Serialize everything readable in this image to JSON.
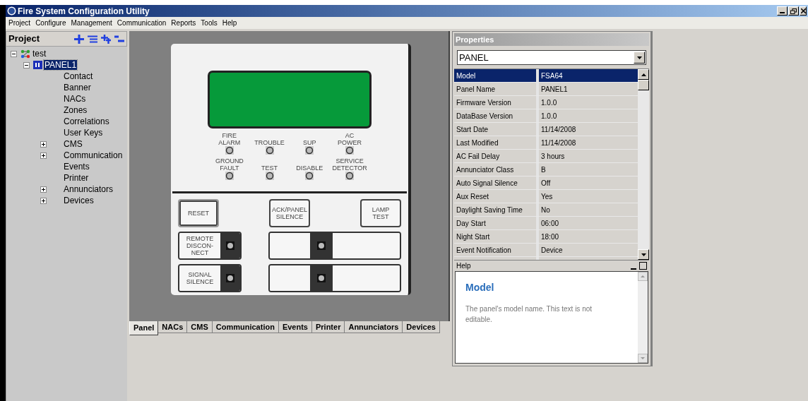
{
  "window": {
    "title": "Fire System Configuration Utility"
  },
  "menu": [
    "Project",
    "Configure",
    "Management",
    "Communication",
    "Reports",
    "Tools",
    "Help"
  ],
  "project": {
    "title": "Project",
    "tree": [
      {
        "label": "test",
        "kind": "root",
        "expanded": true,
        "selected": false,
        "children": [
          {
            "label": "PANEL1",
            "kind": "panel",
            "expanded": true,
            "selected": true,
            "children": [
              {
                "label": "Contact",
                "kind": "leaf",
                "selected": false
              },
              {
                "label": "Banner",
                "kind": "leaf",
                "selected": false
              },
              {
                "label": "NACs",
                "kind": "leaf",
                "selected": false
              },
              {
                "label": "Zones",
                "kind": "leaf",
                "selected": false
              },
              {
                "label": "Correlations",
                "kind": "leaf",
                "selected": false
              },
              {
                "label": "User Keys",
                "kind": "leaf",
                "selected": false
              },
              {
                "label": "CMS",
                "kind": "folder",
                "expanded": false,
                "selected": false
              },
              {
                "label": "Communication",
                "kind": "folder",
                "expanded": false,
                "selected": false
              },
              {
                "label": "Events",
                "kind": "leaf",
                "selected": false
              },
              {
                "label": "Printer",
                "kind": "leaf",
                "selected": false
              },
              {
                "label": "Annunciators",
                "kind": "folder",
                "expanded": false,
                "selected": false
              },
              {
                "label": "Devices",
                "kind": "folder",
                "expanded": false,
                "selected": false
              }
            ]
          }
        ]
      }
    ]
  },
  "panel": {
    "leds": [
      [
        "FIRE",
        "ALARM"
      ],
      [
        "TROUBLE"
      ],
      [
        "SUP"
      ],
      [
        "AC",
        "POWER"
      ],
      [
        "GROUND",
        "FAULT"
      ],
      [
        "TEST"
      ],
      [
        "DISABLE"
      ],
      [
        "SERVICE",
        "DETECTOR"
      ]
    ],
    "keys": [
      {
        "label": [
          "RESET"
        ],
        "kind": "plain",
        "selected": true
      },
      {
        "label": [
          "ACK/PANEL",
          "SILENCE"
        ],
        "kind": "plain",
        "selected": false
      },
      {
        "label": [
          "LAMP",
          "TEST"
        ],
        "kind": "plain",
        "selected": false
      }
    ],
    "led_keys": [
      {
        "label": [
          "REMOTE",
          "DISCON-",
          "NECT"
        ],
        "kind": "single"
      },
      {
        "kind": "double"
      },
      {
        "label": [
          "SIGNAL",
          "SILENCE"
        ],
        "kind": "single"
      },
      {
        "kind": "double"
      }
    ]
  },
  "tabs": [
    {
      "label": "Panel",
      "selected": true
    },
    {
      "label": "NACs",
      "selected": false
    },
    {
      "label": "CMS",
      "selected": false
    },
    {
      "label": "Communication",
      "selected": false
    },
    {
      "label": "Events",
      "selected": false
    },
    {
      "label": "Printer",
      "selected": false
    },
    {
      "label": "Annunciators",
      "selected": false
    },
    {
      "label": "Devices",
      "selected": false
    }
  ],
  "properties": {
    "title": "Properties",
    "object": "PANEL",
    "rows": [
      {
        "name": "Model",
        "value": "FSA64",
        "selected": true
      },
      {
        "name": "Panel Name",
        "value": "PANEL1",
        "selected": false
      },
      {
        "name": "Firmware Version",
        "value": "1.0.0",
        "selected": false
      },
      {
        "name": "DataBase Version",
        "value": "1.0.0",
        "selected": false
      },
      {
        "name": "Start Date",
        "value": "11/14/2008",
        "selected": false
      },
      {
        "name": "Last Modified",
        "value": "11/14/2008",
        "selected": false
      },
      {
        "name": "AC Fail Delay",
        "value": "3 hours",
        "selected": false
      },
      {
        "name": "Annunciator Class",
        "value": "B",
        "selected": false
      },
      {
        "name": "Auto Signal Silence",
        "value": "Off",
        "selected": false
      },
      {
        "name": "Aux Reset",
        "value": "Yes",
        "selected": false
      },
      {
        "name": "Daylight Saving Time",
        "value": "No",
        "selected": false
      },
      {
        "name": "Day Start",
        "value": "06:00",
        "selected": false
      },
      {
        "name": "Night Start",
        "value": "18:00",
        "selected": false
      },
      {
        "name": "Event Notification",
        "value": "Device",
        "selected": false
      }
    ]
  },
  "help": {
    "title": "Help",
    "heading": "Model",
    "text": "The panel's model name. This text is not editable."
  }
}
